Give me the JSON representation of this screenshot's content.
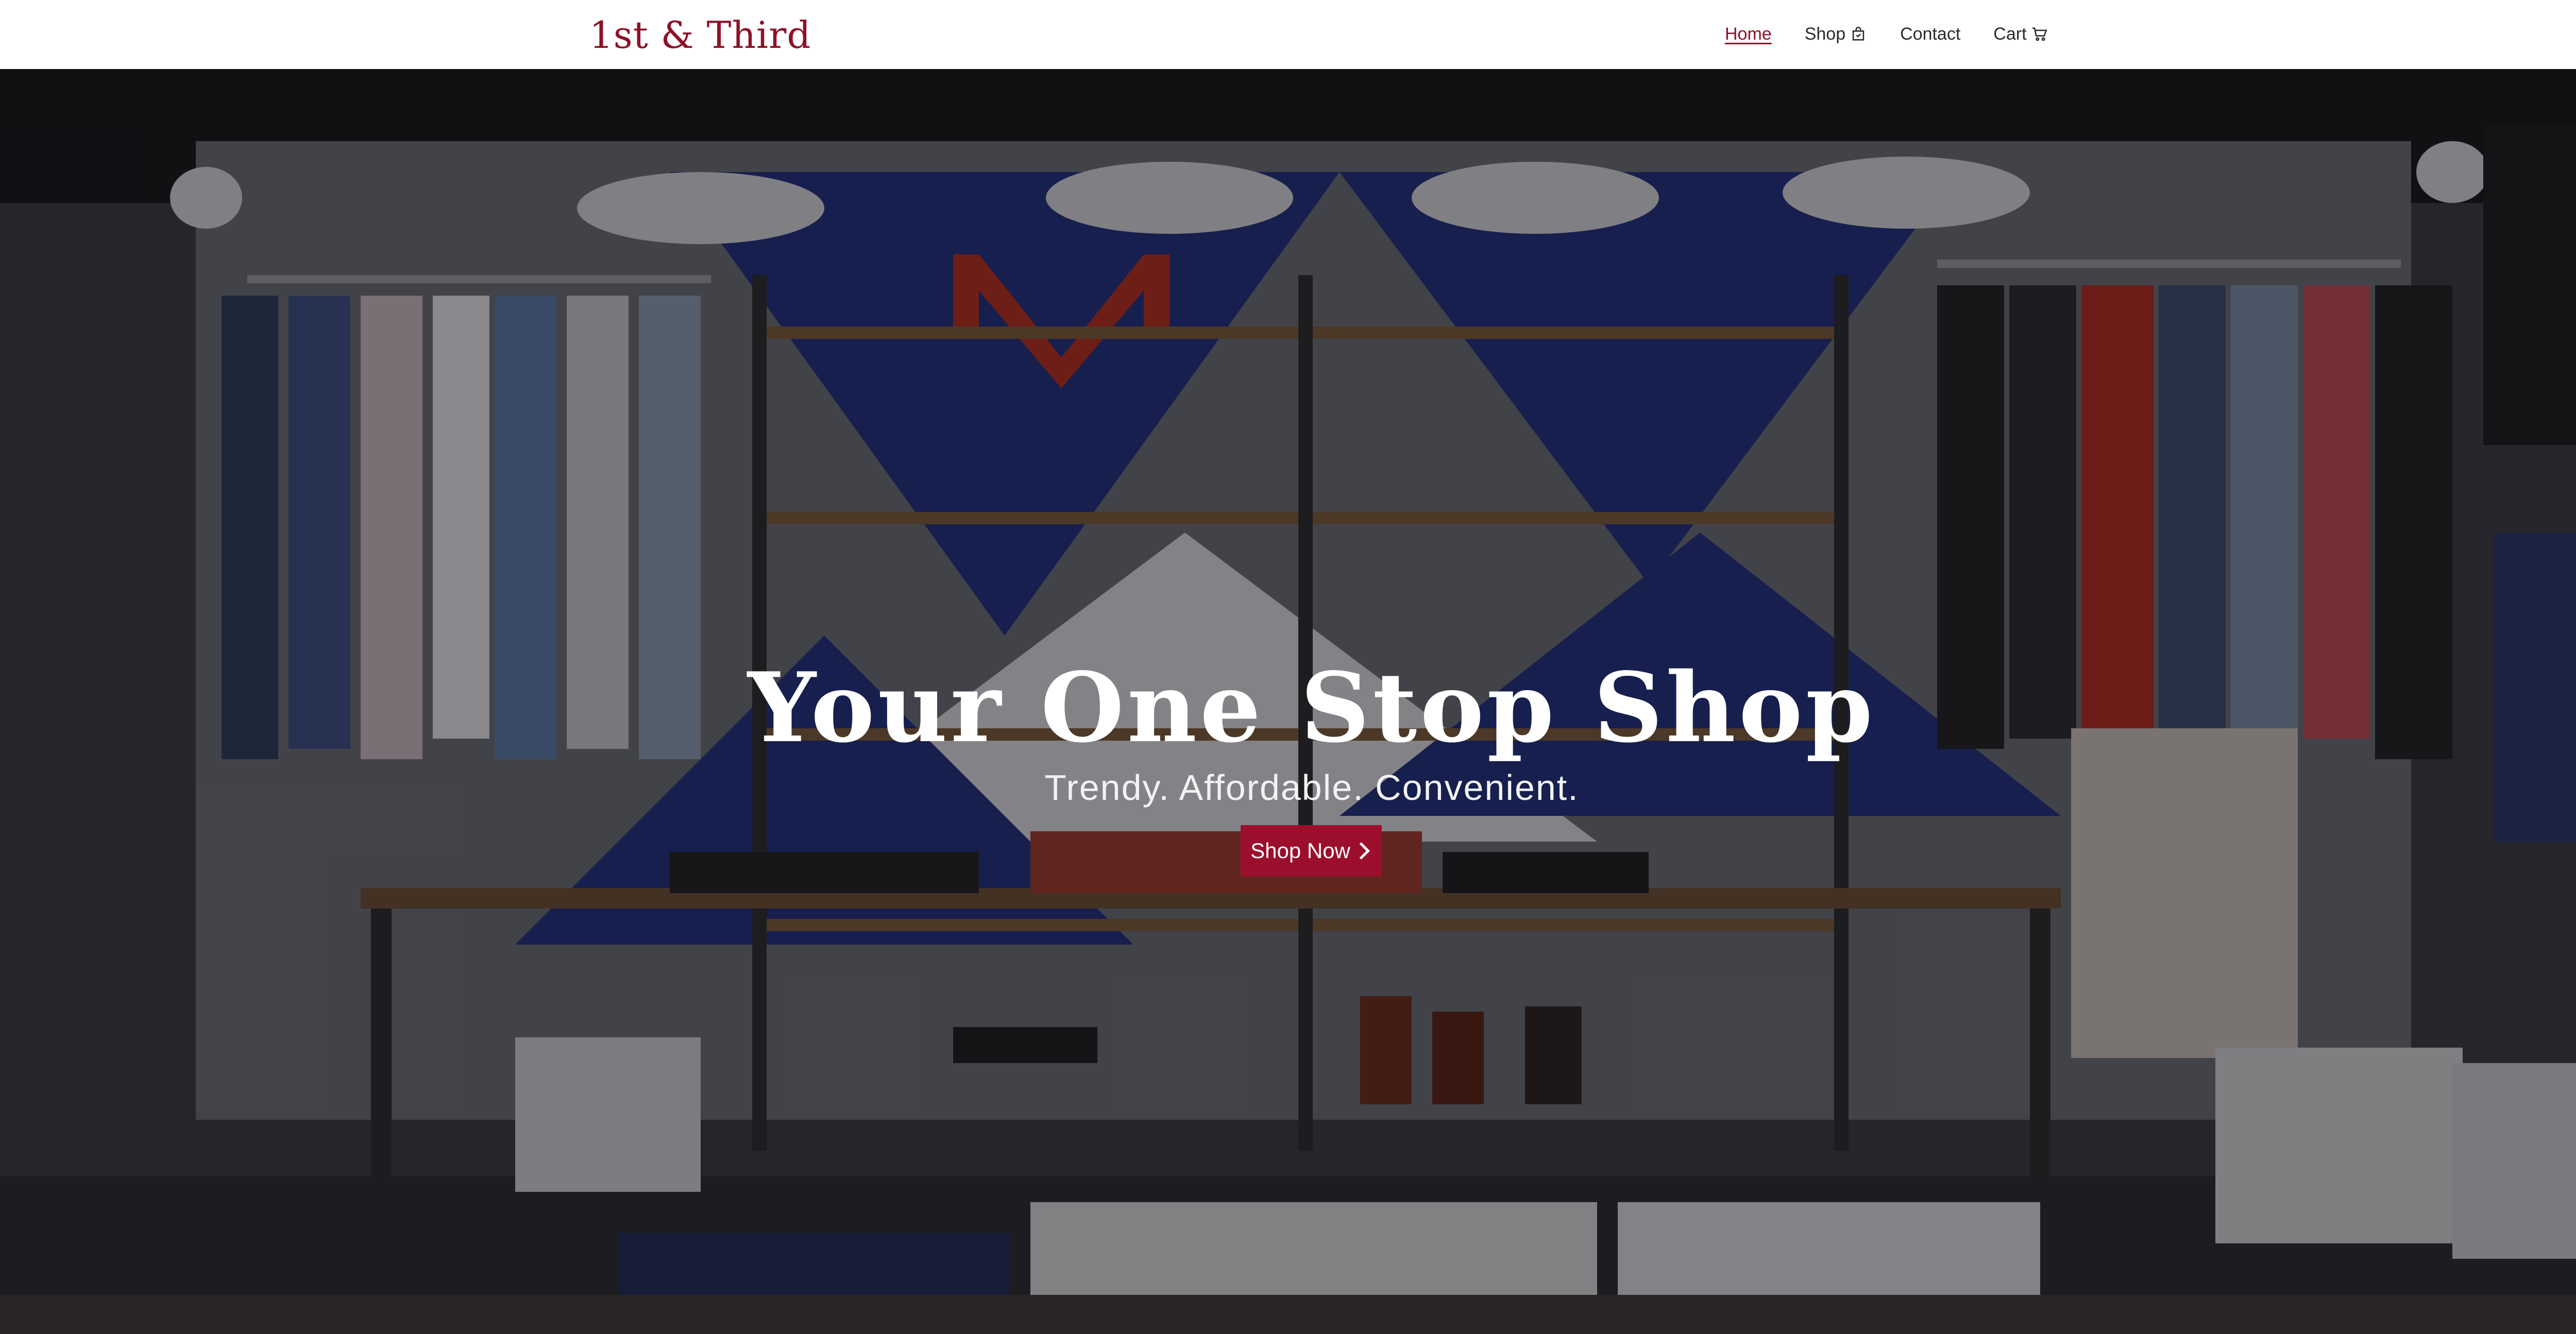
{
  "header": {
    "brand": "1st & Third",
    "nav": [
      {
        "label": "Home",
        "active": true,
        "icon": ""
      },
      {
        "label": "Shop",
        "active": false,
        "icon": "shopping-bag-icon"
      },
      {
        "label": "Contact",
        "active": false,
        "icon": ""
      },
      {
        "label": "Cart",
        "active": false,
        "icon": "cart-icon"
      }
    ]
  },
  "hero": {
    "title": "Your One Stop Shop",
    "subtitle": "Trendy. Affordable. Convenient.",
    "cta_label": "Shop Now",
    "cta_icon": "chevron-right-icon",
    "background": "clothing-store-interior-photo"
  },
  "colors": {
    "brand": "#8c1228",
    "cta": "#9c0f2c",
    "header_bg": "#ffffff",
    "nav_text": "#2b2b2b",
    "hero_text": "#ffffff"
  }
}
